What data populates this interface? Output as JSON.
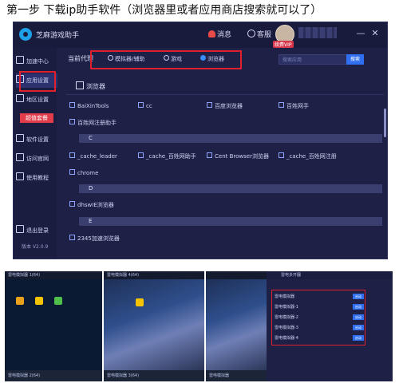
{
  "caption": "第一步 下载ip助手软件（浏览器里或者应用商店搜索就可以了）",
  "app": {
    "title": "芝麻游戏助手",
    "message": "消息",
    "service": "客服",
    "vip_badge": "续费VIP",
    "sidebar": {
      "items": [
        {
          "label": "加速中心",
          "icon": "speed-icon"
        },
        {
          "label": "应用设置",
          "icon": "gear-icon"
        },
        {
          "label": "地区设置",
          "icon": "monitor-icon"
        },
        {
          "label": "软件设置",
          "icon": "settings-icon"
        },
        {
          "label": "访问官网",
          "icon": "globe-icon"
        },
        {
          "label": "使用教程",
          "icon": "book-icon"
        },
        {
          "label": "退出登录",
          "icon": "logout-icon"
        }
      ],
      "promo": "超值套餐",
      "version": "版本 V2.0.9"
    },
    "tabs": {
      "title": "当前代理",
      "options": [
        {
          "label": "模拟器/辅助",
          "selected": false
        },
        {
          "label": "游戏",
          "selected": false
        },
        {
          "label": "浏览器",
          "selected": true
        }
      ]
    },
    "search": {
      "placeholder": "搜索应用",
      "button": "搜索"
    },
    "section": {
      "title": "浏览器"
    },
    "list": {
      "row1": [
        "BaiXinTools",
        "cc",
        "百度浏览器",
        "百姓网手"
      ],
      "row2": [
        "百姓网注册助手"
      ],
      "letter_c": "C",
      "row3": [
        "_cache_leader",
        "_cache_百姓网助手",
        "Cent Browser浏览器",
        "_cache_百姓网注册"
      ],
      "row4": [
        "chrome"
      ],
      "letter_d": "D",
      "row5": [
        "dhswIE浏览器"
      ],
      "letter_e": "E",
      "row6": [
        "2345加速浏览器"
      ]
    }
  },
  "screenshots": {
    "shot1_title": "雷电模拟器 1(64)",
    "shot1_bottom": "雷电模拟器 2(64)",
    "shot2_title": "雷电模拟器 4(64)",
    "shot2_bottom": "雷电模拟器 3(64)",
    "manager_title": "雷电多开器",
    "manager_rows": [
      "雷电模拟器",
      "雷电模拟器-1",
      "雷电模拟器-2",
      "雷电模拟器-3",
      "雷电模拟器-4"
    ],
    "manager_btn": "启动",
    "manager_bottom": "雷电模拟器"
  }
}
